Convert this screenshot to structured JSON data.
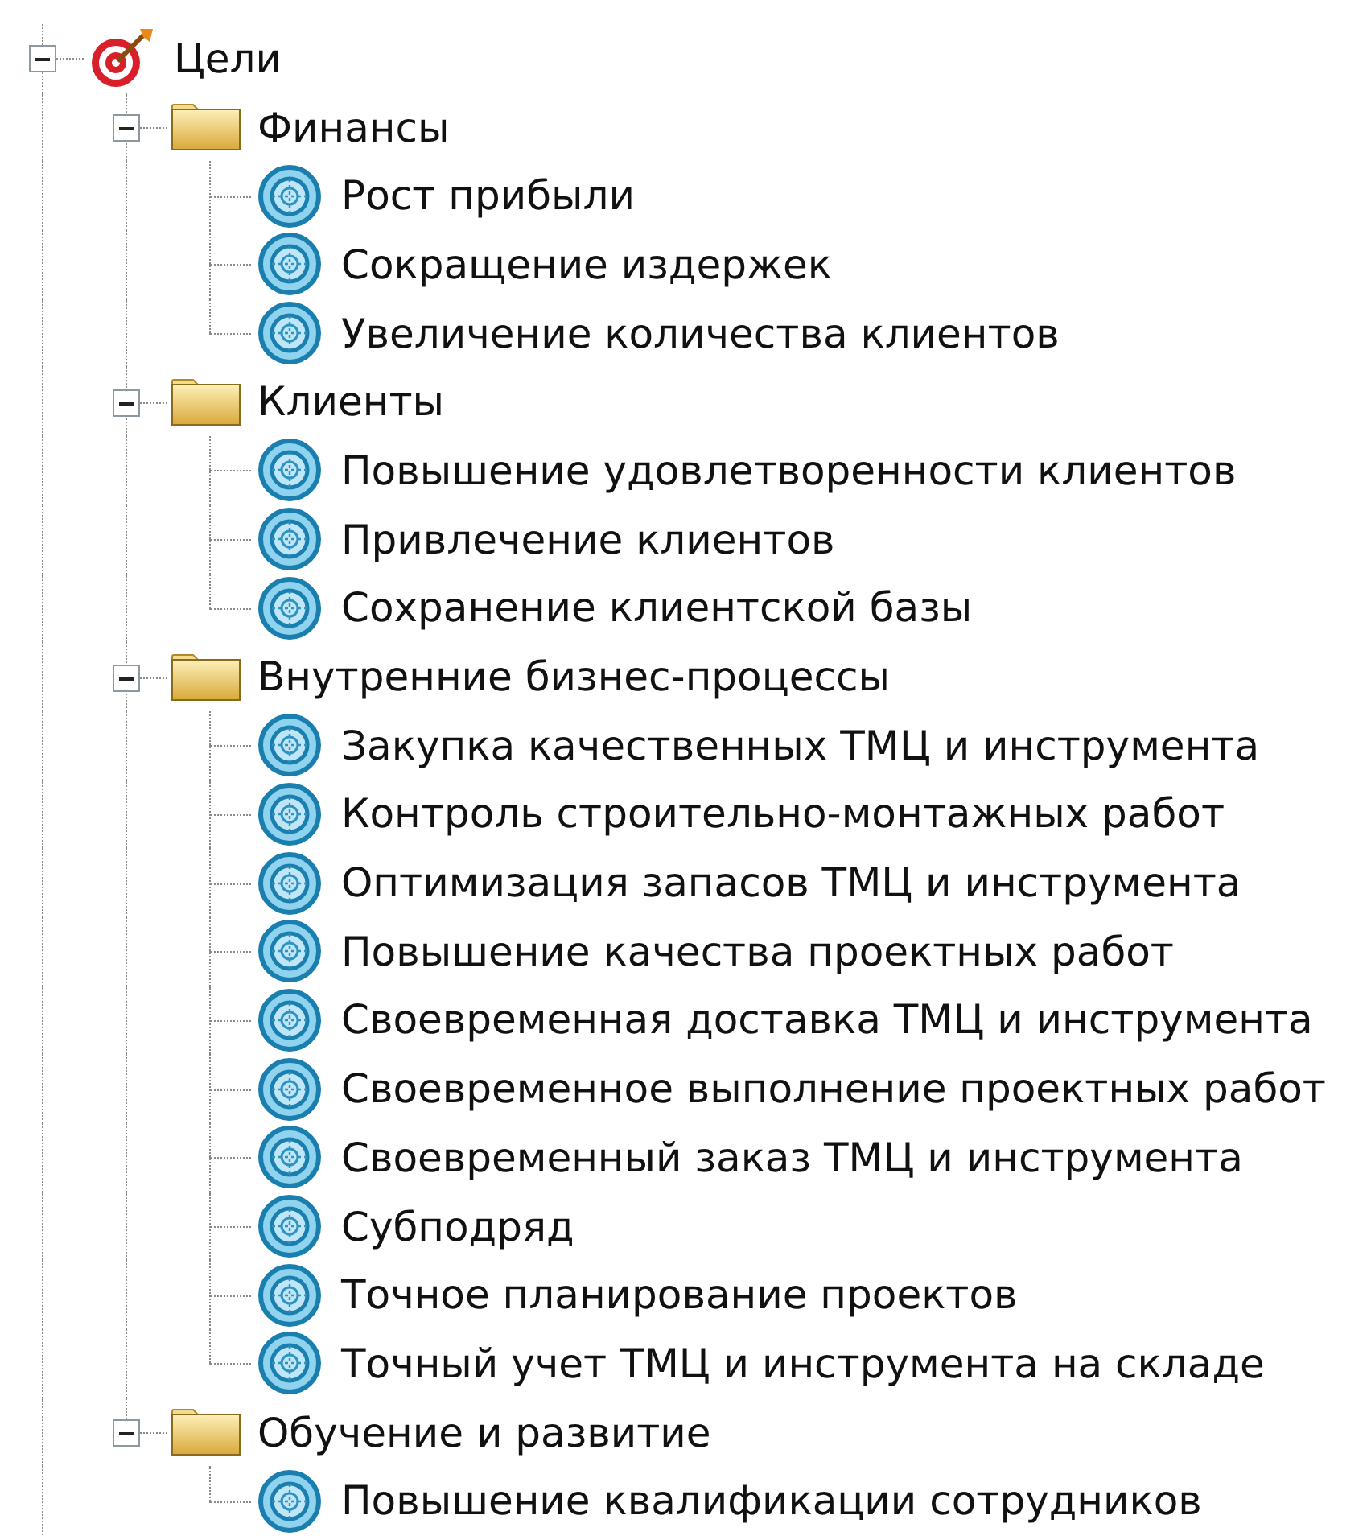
{
  "tree": [
    {
      "label": "Цели",
      "kind": "root",
      "expanded": true,
      "children": [
        {
          "label": "Финансы",
          "kind": "folder",
          "expanded": true,
          "children": [
            {
              "label": "Рост прибыли",
              "kind": "goal"
            },
            {
              "label": "Сокращение издержек",
              "kind": "goal"
            },
            {
              "label": "Увеличение количества клиентов",
              "kind": "goal"
            }
          ]
        },
        {
          "label": "Клиенты",
          "kind": "folder",
          "expanded": true,
          "children": [
            {
              "label": "Повышение удовлетворенности клиентов",
              "kind": "goal"
            },
            {
              "label": "Привлечение клиентов",
              "kind": "goal"
            },
            {
              "label": "Сохранение клиентской базы",
              "kind": "goal"
            }
          ]
        },
        {
          "label": "Внутренние бизнес-процессы",
          "kind": "folder",
          "expanded": true,
          "children": [
            {
              "label": "Закупка качественных ТМЦ и инструмента",
              "kind": "goal"
            },
            {
              "label": "Контроль строительно-монтажных работ",
              "kind": "goal"
            },
            {
              "label": "Оптимизация запасов ТМЦ и инструмента",
              "kind": "goal"
            },
            {
              "label": "Повышение качества проектных работ",
              "kind": "goal"
            },
            {
              "label": "Своевременная доставка ТМЦ и инструмента",
              "kind": "goal"
            },
            {
              "label": "Своевременное выполнение проектных работ",
              "kind": "goal"
            },
            {
              "label": "Своевременный заказ ТМЦ и инструмента",
              "kind": "goal"
            },
            {
              "label": "Субподряд",
              "kind": "goal"
            },
            {
              "label": "Точное планирование проектов",
              "kind": "goal"
            },
            {
              "label": "Точный учет ТМЦ и инструмента на складе",
              "kind": "goal"
            }
          ]
        },
        {
          "label": "Обучение и развитие",
          "kind": "folder",
          "expanded": true,
          "children": [
            {
              "label": "Повышение квалификации сотрудников",
              "kind": "goal"
            }
          ]
        }
      ]
    }
  ]
}
